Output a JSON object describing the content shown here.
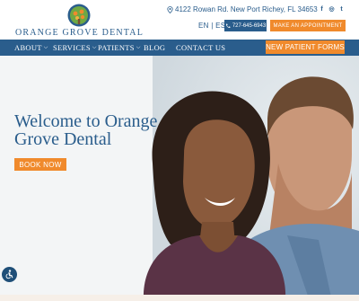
{
  "header": {
    "logo_text": "ORANGE GROVE DENTAL",
    "address": "4122 Rowan Rd. New Port Richey, FL 34653",
    "social": [
      "f",
      "◎",
      "t"
    ],
    "language": "EN | ES",
    "phone": "727-645-6943",
    "appointment_label": "MAKE AN APPOINTMENT"
  },
  "nav": {
    "items": [
      {
        "label": "ABOUT",
        "dropdown": true
      },
      {
        "label": "SERVICES",
        "dropdown": true
      },
      {
        "label": "PATIENTS",
        "dropdown": true
      },
      {
        "label": "BLOG",
        "dropdown": false
      },
      {
        "label": "CONTACT US",
        "dropdown": false
      }
    ],
    "new_patient_label": "NEW PATIENT FORMS"
  },
  "hero": {
    "heading": "Welcome to Orange Grove Dental",
    "book_label": "BOOK NOW"
  },
  "colors": {
    "brand_blue": "#2a5d8c",
    "accent_orange": "#f08a2c"
  },
  "icons": {
    "location": "map-pin-icon",
    "phone": "phone-icon",
    "accessibility": "accessibility-icon",
    "facebook": "facebook-icon",
    "instagram": "instagram-icon",
    "twitter": "twitter-icon"
  }
}
